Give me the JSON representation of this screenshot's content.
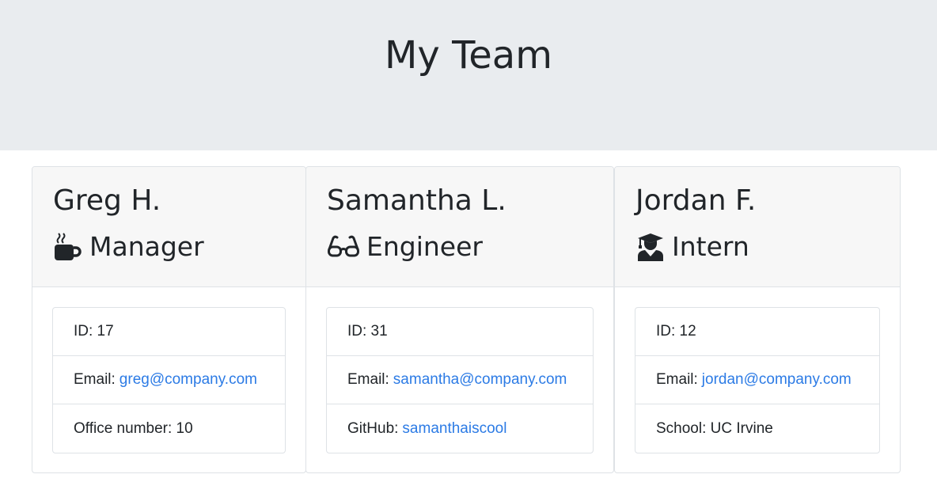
{
  "header": {
    "title": "My Team"
  },
  "cards": [
    {
      "name": "Greg H.",
      "role": "Manager",
      "icon": "coffee-mug-icon",
      "id_label": "ID: 17",
      "email_label": "Email:",
      "email": "greg@company.com",
      "extra_label": "Office number: 10",
      "extra_link": ""
    },
    {
      "name": "Samantha L.",
      "role": "Engineer",
      "icon": "glasses-icon",
      "id_label": "ID: 31",
      "email_label": "Email:",
      "email": "samantha@company.com",
      "extra_label": "GitHub:",
      "extra_link": "samanthaiscool"
    },
    {
      "name": "Jordan F.",
      "role": "Intern",
      "icon": "graduate-icon",
      "id_label": "ID: 12",
      "email_label": "Email:",
      "email": "jordan@company.com",
      "extra_label": "School: UC Irvine",
      "extra_link": ""
    }
  ],
  "colors": {
    "link": "#2c7be5",
    "header_bg": "#e9ecef",
    "card_header_bg": "#f7f7f7"
  }
}
